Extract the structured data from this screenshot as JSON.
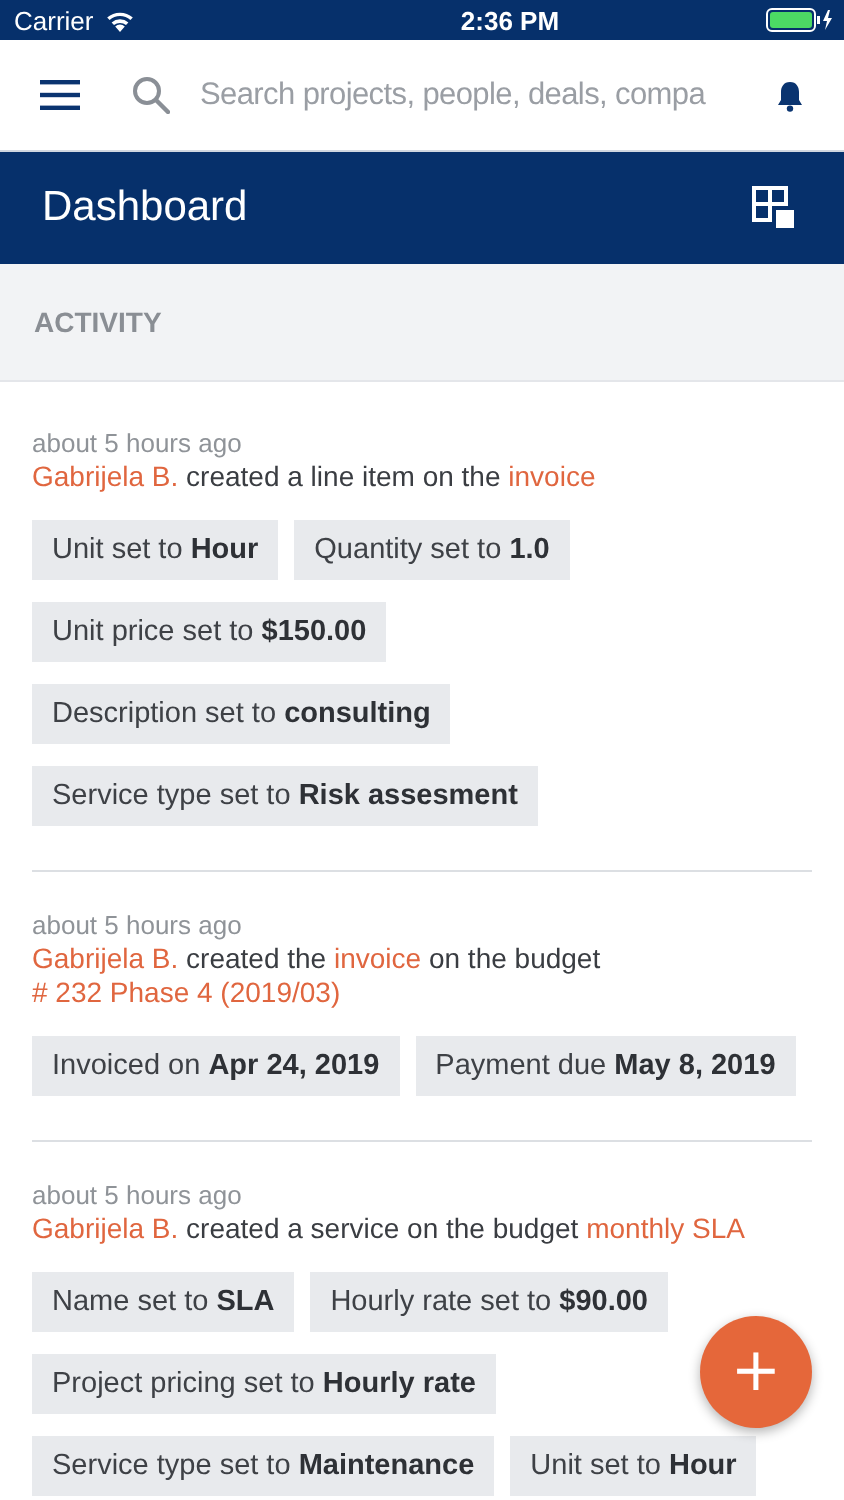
{
  "status_bar": {
    "carrier": "Carrier",
    "time": "2:36 PM"
  },
  "search": {
    "placeholder": "Search projects, people, deals, compa"
  },
  "header": {
    "title": "Dashboard"
  },
  "section": {
    "title": "ACTIVITY"
  },
  "activities": [
    {
      "time": "about 5 hours ago",
      "sentence": [
        {
          "kind": "link",
          "text": "Gabrijela B."
        },
        {
          "kind": "text",
          "text": " created a line item on the "
        },
        {
          "kind": "link",
          "text": "invoice"
        }
      ],
      "changes": [
        "Unit set to **Hour**",
        "Quantity set to **1.0**",
        "Unit price set to **$150.00**",
        "Description set to **consulting**",
        "Service type set to **Risk assesment**"
      ]
    },
    {
      "time": "about 5 hours ago",
      "sentence": [
        {
          "kind": "link",
          "text": "Gabrijela B."
        },
        {
          "kind": "text",
          "text": " created the "
        },
        {
          "kind": "link",
          "text": "invoice"
        },
        {
          "kind": "text",
          "text": " on the budget "
        },
        {
          "kind": "link",
          "text": "# 232 Phase 4 (2019/03)"
        }
      ],
      "changes": [
        "Invoiced on **Apr 24, 2019**",
        "Payment due **May 8, 2019**"
      ]
    },
    {
      "time": "about 5 hours ago",
      "sentence": [
        {
          "kind": "link",
          "text": "Gabrijela B."
        },
        {
          "kind": "text",
          "text": " created a service on the budget "
        },
        {
          "kind": "link",
          "text": "monthly SLA"
        }
      ],
      "changes": [
        "Name set to **SLA**",
        "Hourly rate set to **$90.00**",
        "Project pricing set to **Hourly rate**",
        "Service type set to **Maintenance**",
        "Unit set to **Hour**"
      ]
    }
  ],
  "fab": {
    "label": "+"
  }
}
